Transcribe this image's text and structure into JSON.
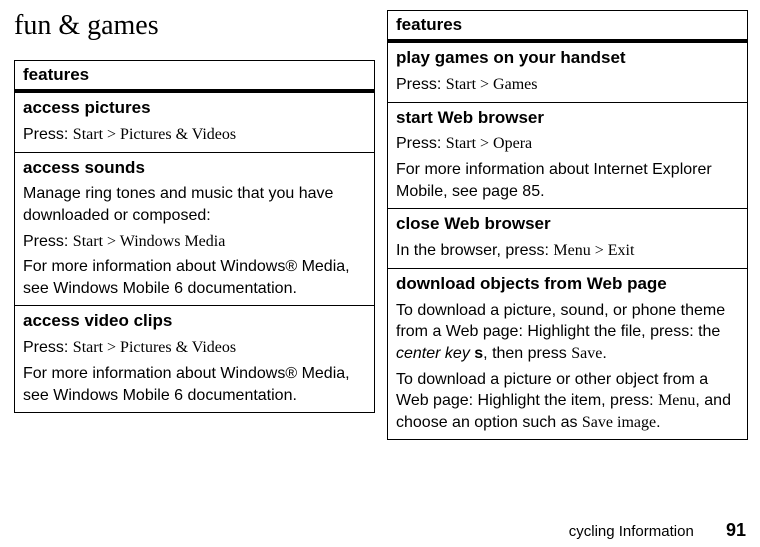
{
  "page": {
    "title": "fun & games",
    "footer_text": "cycling Information",
    "page_number": "91"
  },
  "table1": {
    "header": "features",
    "rows": {
      "r1": {
        "name": "access pictures",
        "p1a": "Press: ",
        "p1b": "Start",
        "p1c": " > ",
        "p1d": "Pictures & Videos"
      },
      "r2": {
        "name": "access sounds",
        "p1": "Manage ring tones and music that you have downloaded or composed:",
        "p2a": "Press: ",
        "p2b": "Start",
        "p2c": " > ",
        "p2d": "Windows Media",
        "p3": "For more information about Windows® Media, see Windows Mobile 6 documentation."
      },
      "r3": {
        "name": "access video clips",
        "p1a": "Press: ",
        "p1b": "Start",
        "p1c": " > ",
        "p1d": "Pictures & Videos",
        "p2": "For more information about Windows® Media, see Windows Mobile 6 documentation."
      }
    }
  },
  "table2": {
    "header": "features",
    "rows": {
      "r1": {
        "name": "play games on your handset",
        "p1a": "Press: ",
        "p1b": "Start",
        "p1c": " > ",
        "p1d": "Games"
      },
      "r2": {
        "name": "start Web browser",
        "p1a": "Press: ",
        "p1b": "Start",
        "p1c": " > ",
        "p1d": "Opera",
        "p2": "For more information about Internet Explorer Mobile, see page 85."
      },
      "r3": {
        "name": "close Web browser",
        "p1a": "In the browser, press: ",
        "p1b": "Menu",
        "p1c": " > ",
        "p1d": "Exit"
      },
      "r4": {
        "name": "download objects from Web page",
        "p1a": "To download a picture, sound, or phone theme from a Web page: Highlight the file, press: the ",
        "p1b": "center key",
        "p1c": " ",
        "p1d": "s",
        "p1e": ", then press ",
        "p1f": "Save",
        "p1g": ".",
        "p2a": "To download a picture or other object from a Web page: Highlight the item, press: ",
        "p2b": "Menu",
        "p2c": ", and choose an option such as ",
        "p2d": "Save image",
        "p2e": "."
      }
    }
  }
}
